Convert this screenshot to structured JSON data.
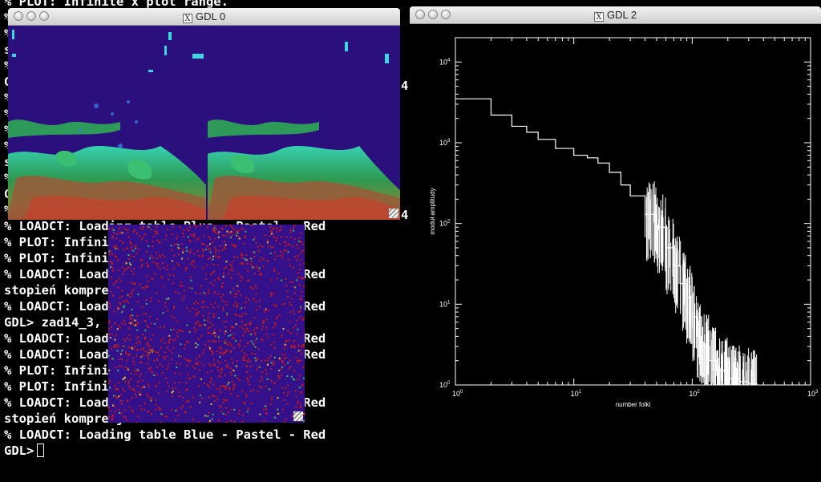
{
  "terminal": {
    "lines": [
      "% PLOT: Infinite x plot range.",
      "%",
      "%",
      "s",
      "%",
      "G",
      "%",
      "%",
      "%",
      "%",
      "s",
      "%",
      "G",
      "% LOADCT: Loading table Blue - Pastel - Red",
      "% LOADCT: Loading table Blue - Pastel - Red",
      "% PLOT: Infinite x plot range.",
      "% PLOT: Infinite x plot range.",
      "% LOADCT: Loading table Blue - Pastel - Red",
      "stopień kompresji:",
      "% LOADCT: Loading table Blue - Pastel - Red",
      "GDL> zad14_3, 20071002140068421400684",
      "% LOADCT: Loading table Blue - Pastel - Red",
      "% LOADCT: Loading table Blue - Pastel - Red",
      "% PLOT: Infinite x plot range.",
      "% PLOT: Infinite x plot range.",
      "% LOADCT: Loading table Blue - Pastel - Red",
      "stopień kompresji:       5.46133",
      "% LOADCT: Loading table Blue - Pastel - Red",
      "GDL>"
    ],
    "side_chars": [
      "4",
      "4"
    ]
  },
  "windows": {
    "gdl0": {
      "title": "GDL 0"
    },
    "gdl2": {
      "title": "GDL 2"
    },
    "noise": {
      "title": ""
    }
  },
  "chart_data": {
    "type": "line",
    "xlabel": "number folki",
    "ylabel": "moduł amplitudy",
    "x_scale": "log",
    "y_scale": "log",
    "xlim": [
      1,
      1000
    ],
    "ylim": [
      1,
      20000
    ],
    "x_ticks": [
      1,
      10,
      100,
      1000
    ],
    "y_ticks": [
      1,
      10,
      100,
      1000,
      10000
    ],
    "series": [
      {
        "x": [
          1,
          1.4,
          2,
          3,
          4,
          5,
          7,
          10,
          13,
          16,
          20,
          25,
          30,
          40,
          50,
          60,
          70,
          80,
          90,
          100,
          110,
          120,
          140,
          160,
          200,
          250,
          300,
          350
        ],
        "y": [
          3500,
          3500,
          2200,
          1600,
          1350,
          1100,
          850,
          700,
          650,
          560,
          430,
          300,
          220,
          130,
          90,
          50,
          30,
          18,
          12,
          7,
          4,
          3,
          2,
          1.5,
          1.2,
          1.1,
          1.05,
          1
        ]
      }
    ]
  },
  "colors": {
    "terminal_bg": "#000000",
    "terminal_fg": "#ffffff",
    "map_bg": "#2b0f7d",
    "noise_bg": "#34108a",
    "noise_red": "#c21a1a"
  }
}
